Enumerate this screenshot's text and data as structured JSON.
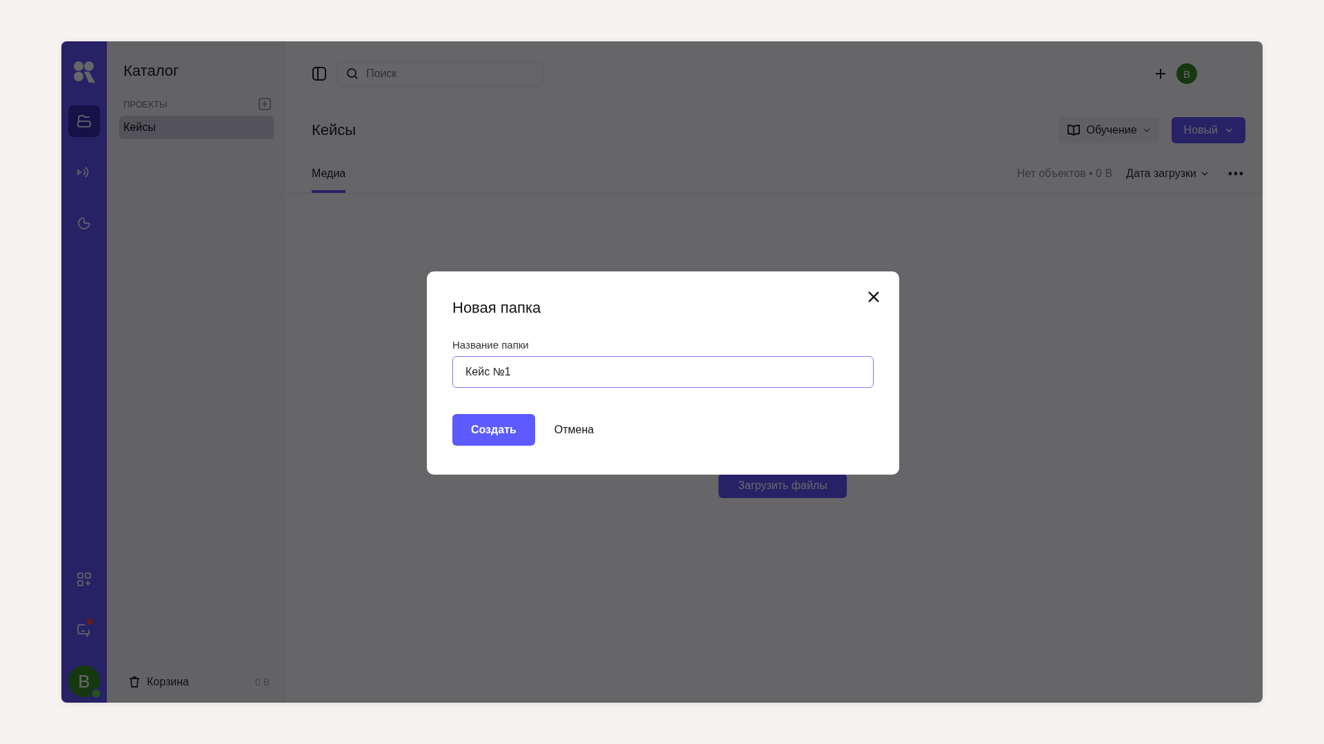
{
  "rail": {
    "items": [
      {
        "kind": "catalog",
        "selected": true,
        "has_notification": false
      },
      {
        "kind": "broadcast",
        "selected": false,
        "has_notification": false
      },
      {
        "kind": "analytics",
        "selected": false,
        "has_notification": false
      }
    ],
    "bottom_items": [
      {
        "kind": "apps",
        "selected": false,
        "has_notification": false
      },
      {
        "kind": "chat",
        "selected": false,
        "has_notification": true
      }
    ],
    "avatar": {
      "letter": "B",
      "online": true
    }
  },
  "sidebar": {
    "title": "Каталог",
    "section": "ПРОЕКТЫ",
    "items": [
      {
        "label": "Кейсы",
        "selected": true
      }
    ],
    "trash": {
      "label": "Корзина",
      "size": "0 B"
    }
  },
  "topbar": {
    "search": {
      "placeholder": "Поиск"
    },
    "avatar": {
      "letter": "B"
    }
  },
  "header": {
    "title": "Кейсы",
    "learn_button": "Обучение",
    "new_button": "Новый"
  },
  "tabs": [
    {
      "label": "Медиа",
      "selected": true
    }
  ],
  "summary": "Нет объектов • 0 B",
  "sort": "Дата загрузки",
  "upload_button": "Загрузить файлы",
  "dialog": {
    "title": "Новая папка",
    "field_label": "Название папки",
    "field_value": "Кейс №1",
    "primary": "Создать",
    "secondary": "Отмена"
  }
}
